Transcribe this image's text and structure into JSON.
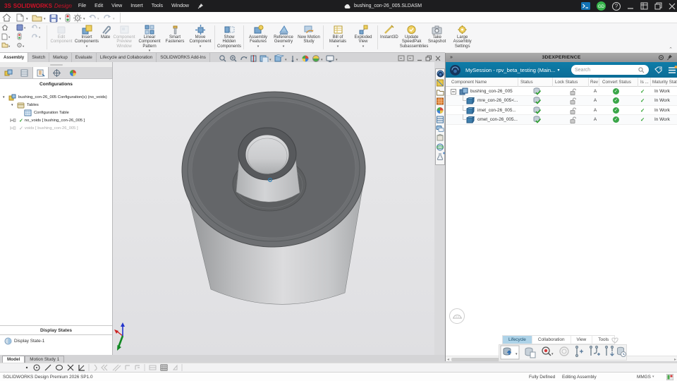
{
  "titlebar": {
    "logo": "3S",
    "brand": "SOLIDWORKS",
    "brand2": "Design",
    "menus": [
      "File",
      "Edit",
      "View",
      "Insert",
      "Tools",
      "Window"
    ],
    "doc": "bushing_con-26_005.SLDASM"
  },
  "ribbon": {
    "buttons": [
      {
        "label": "Edit Component"
      },
      {
        "label": "Insert Components"
      },
      {
        "label": "Mate"
      },
      {
        "label": "Component Preview Window"
      },
      {
        "label": "Linear Component Pattern"
      },
      {
        "label": "Smart Fasteners"
      },
      {
        "label": "Move Component"
      },
      {
        "label": "Show Hidden Components"
      },
      {
        "label": "Assembly Features"
      },
      {
        "label": "Reference Geometry"
      },
      {
        "label": "New Motion Study"
      },
      {
        "label": "Bill of Materials"
      },
      {
        "label": "Exploded View"
      },
      {
        "label": "Instant3D"
      },
      {
        "label": "Update SpeedPak Subassemblies"
      },
      {
        "label": "Take Snapshot"
      },
      {
        "label": "Large Assembly Settings"
      }
    ]
  },
  "tabs": [
    "Assembly",
    "Sketch",
    "Markup",
    "Evaluate",
    "Lifecycle and Collaboration",
    "SOLIDWORKS Add-Ins"
  ],
  "left_panel": {
    "title": "Configurations",
    "tree": [
      {
        "label": "bushing_con-26_005 Configuration(s)  (no_voids)"
      },
      {
        "label": "Tables"
      },
      {
        "label": "Configuration Table"
      },
      {
        "label": "no_voids [ bushing_con-26_005 ]"
      },
      {
        "label": "voids [ bushing_con-26_005 ]"
      }
    ],
    "display_states_title": "Display States",
    "display_state": "Display State-1"
  },
  "right_panel": {
    "title": "3DEXPERIENCE",
    "session": "MySession - rpv_beta_testing (Main...",
    "search_placeholder": "Search",
    "columns": [
      "Component Name",
      "Status",
      "Lock Status",
      "Rev",
      "Convert Status",
      "Is ...",
      "Maturity Stat..."
    ],
    "rows": [
      {
        "name": "bushing_con-26_005",
        "rev": "A",
        "maturity": "In Work"
      },
      {
        "name": "mre_con-26_005<...",
        "rev": "A",
        "maturity": "In Work"
      },
      {
        "name": "imet_con-26_005...",
        "rev": "A",
        "maturity": "In Work"
      },
      {
        "name": "omet_con-26_005...",
        "rev": "A",
        "maturity": "In Work"
      }
    ],
    "tabs": [
      "Lifecycle",
      "Collaboration",
      "View",
      "Tools"
    ]
  },
  "model_tabs": [
    "Model",
    "Motion Study 1"
  ],
  "statusbar": {
    "app": "SOLIDWORKS Design Premium 2026 SP1.0",
    "defined": "Fully Defined",
    "mode": "Editing Assembly",
    "units": "MMGS"
  }
}
